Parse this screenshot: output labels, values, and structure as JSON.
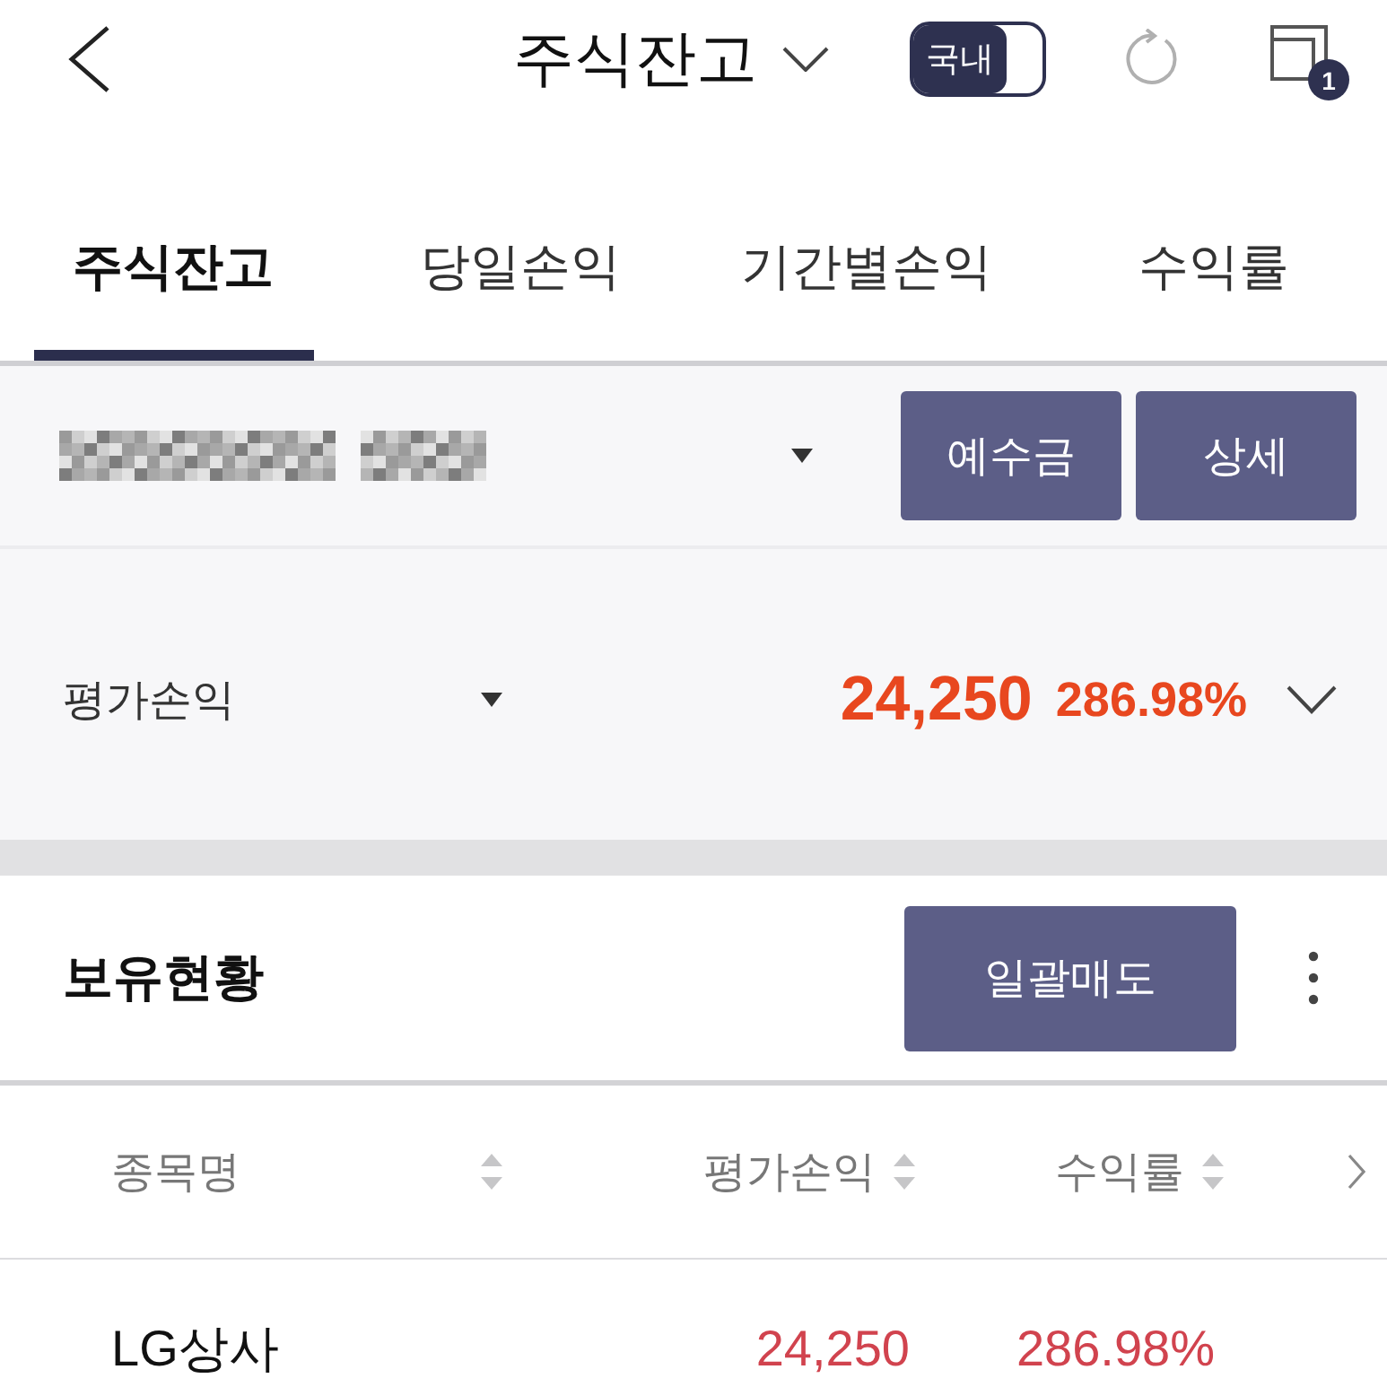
{
  "header": {
    "title": "주식잔고",
    "market_toggle": {
      "label": "국내",
      "on": true
    },
    "notification_count": "1"
  },
  "tabs": [
    {
      "label": "주식잔고",
      "selected": true
    },
    {
      "label": "당일손익",
      "selected": false
    },
    {
      "label": "기간별손익",
      "selected": false
    },
    {
      "label": "수익률",
      "selected": false
    }
  ],
  "account": {
    "buttons": [
      "예수금",
      "상세"
    ]
  },
  "summary": {
    "label": "평가손익",
    "amount": "24,250",
    "rate": "286.98%"
  },
  "holdings": {
    "title": "보유현황",
    "sell_all_button": "일괄매도",
    "columns": [
      {
        "label": "종목명"
      },
      {
        "label": "평가손익"
      },
      {
        "label": "수익률"
      }
    ],
    "rows": [
      {
        "name": "LG상사",
        "profit": "24,250",
        "rate": "286.98%"
      }
    ]
  }
}
